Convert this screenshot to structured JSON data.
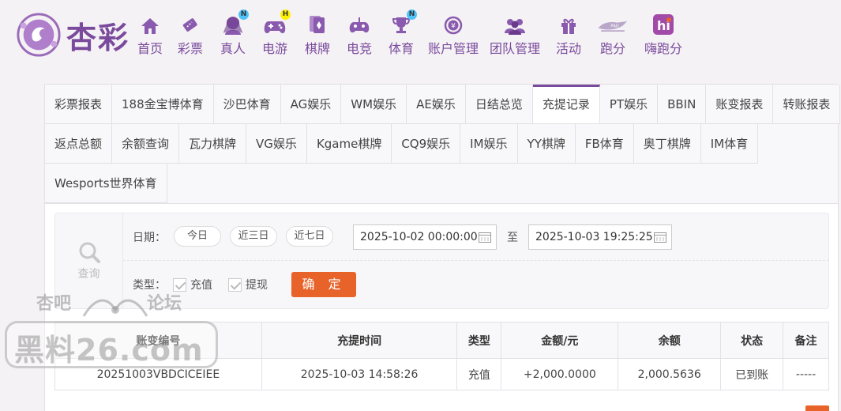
{
  "brand": {
    "name": "杏彩"
  },
  "nav": [
    {
      "label": "首页",
      "icon": "home-icon",
      "badge": ""
    },
    {
      "label": "彩票",
      "icon": "lottery-ticket-icon",
      "badge": ""
    },
    {
      "label": "真人",
      "icon": "live-dealer-icon",
      "badge": "N"
    },
    {
      "label": "电游",
      "icon": "gamepad-icon",
      "badge": "H"
    },
    {
      "label": "棋牌",
      "icon": "cards-icon",
      "badge": ""
    },
    {
      "label": "电竞",
      "icon": "esports-icon",
      "badge": ""
    },
    {
      "label": "体育",
      "icon": "trophy-icon",
      "badge": "N"
    },
    {
      "label": "账户管理",
      "icon": "account-icon",
      "badge": ""
    },
    {
      "label": "团队管理",
      "icon": "team-icon",
      "badge": ""
    },
    {
      "label": "活动",
      "icon": "gift-icon",
      "badge": ""
    },
    {
      "label": "跑分",
      "icon": "running-score-icon",
      "badge": ""
    },
    {
      "label": "嗨跑分",
      "icon": "hi-running-score-icon",
      "badge": ""
    }
  ],
  "tabs": {
    "row1": [
      "彩票报表",
      "188金宝博体育",
      "沙巴体育",
      "AG娱乐",
      "WM娱乐",
      "AE娱乐",
      "日结总览",
      "充提记录",
      "PT娱乐",
      "BBIN",
      "账变报表",
      "转账报表"
    ],
    "row2": [
      "返点总额",
      "余额查询",
      "瓦力棋牌",
      "VG娱乐",
      "Kgame棋牌",
      "CQ9娱乐",
      "IM娱乐",
      "YY棋牌",
      "FB体育",
      "奥丁棋牌",
      "IM体育"
    ],
    "row3": [
      "Wesports世界体育"
    ],
    "active": "充提记录"
  },
  "filter": {
    "query_label": "查询",
    "date_label": "日期：",
    "quick_dates": [
      "今日",
      "近三日",
      "近七日"
    ],
    "start_date": "2025-10-02 00:00:00",
    "to_label": "至",
    "end_date": "2025-10-03 19:25:25",
    "type_label": "类型：",
    "types": [
      {
        "label": "充值",
        "checked": true
      },
      {
        "label": "提现",
        "checked": true
      }
    ],
    "confirm_label": "确 定"
  },
  "table": {
    "headers": [
      "账变编号",
      "充提时间",
      "类型",
      "金额/元",
      "余额",
      "状态",
      "备注"
    ],
    "rows": [
      [
        "20251003VBDCICEIEE",
        "2025-10-03 14:58:26",
        "充值",
        "+2,000.0000",
        "2,000.5636",
        "已到账",
        "-----"
      ]
    ]
  },
  "watermark": {
    "line1_left": "杏吧",
    "line1_right": "论坛",
    "main": "黑料26.com"
  },
  "colors": {
    "brand": "#7a4a9c",
    "accent": "#e8632a",
    "amount": "#d32f2f",
    "status_ok": "#2e9a2e"
  }
}
